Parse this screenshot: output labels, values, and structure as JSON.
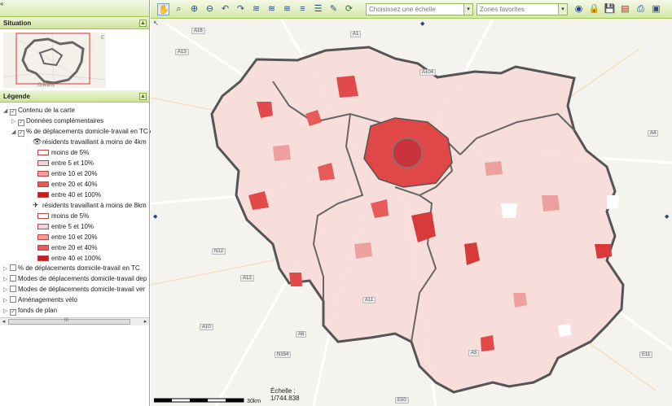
{
  "left_panel": {
    "collapse_symbol": "«",
    "situation": {
      "title": "Situation",
      "toggle": "▲",
      "map_labels": [
        "Orleans",
        "E"
      ]
    },
    "legend": {
      "title": "Légende",
      "toggle": "▲",
      "root": "Contenu de la carte",
      "items": [
        "Données complémentaires",
        "% de déplacements domicile-travail en TC e",
        "% de déplacements domicile-travail en TC",
        "Modes de déplacements domicile-travail dep",
        "Modes de déplacements domicile-travail ver",
        "Aménagements vélo",
        "fonds de plan"
      ],
      "group_walk": {
        "label": "résidents travaillant à moins de 4km",
        "classes": [
          "moins de 5%",
          "entre 5 et 10%",
          "entre 10 et 20%",
          "entre 20 et 40%",
          "entre 40 et 100%"
        ]
      },
      "group_bike": {
        "label": "résidents travaillant à moins de 8km",
        "classes": [
          "moins de 5%",
          "entre 5 et 10%",
          "entre 10 et 20%",
          "entre 20 et 40%",
          "entre 40 et 100%"
        ]
      },
      "class_colors": [
        "#ffffff",
        "#f6d3d3",
        "#eea0a0",
        "#e65a5a",
        "#cc1a1a"
      ],
      "scroll_thumb_glyph": "III"
    }
  },
  "toolbar": {
    "scale_placeholder": "Choisissez une échelle",
    "favorites_placeholder": "Zones favorites",
    "dropdown_arrow": "▾",
    "tools": [
      "pan-icon",
      "zoom-box-icon",
      "zoom-in-icon",
      "zoom-out-icon",
      "previous-view-icon",
      "next-view-icon",
      "layers-icon",
      "layers2-icon",
      "layers3-icon",
      "layers4-icon",
      "list-icon",
      "draw-icon",
      "refresh-icon",
      "globe-icon",
      "lock-icon",
      "save-icon",
      "pdf-icon",
      "print-icon",
      "window-icon"
    ]
  },
  "map": {
    "scale_label": "30km",
    "echelle_title": "Échelle :",
    "echelle_value": "1/744.838",
    "road_labels": [
      "A16",
      "A1",
      "A13",
      "A10",
      "N154",
      "A4",
      "E11",
      "A5",
      "A6",
      "E50",
      "A11",
      "N12",
      "A12",
      "A104"
    ]
  }
}
